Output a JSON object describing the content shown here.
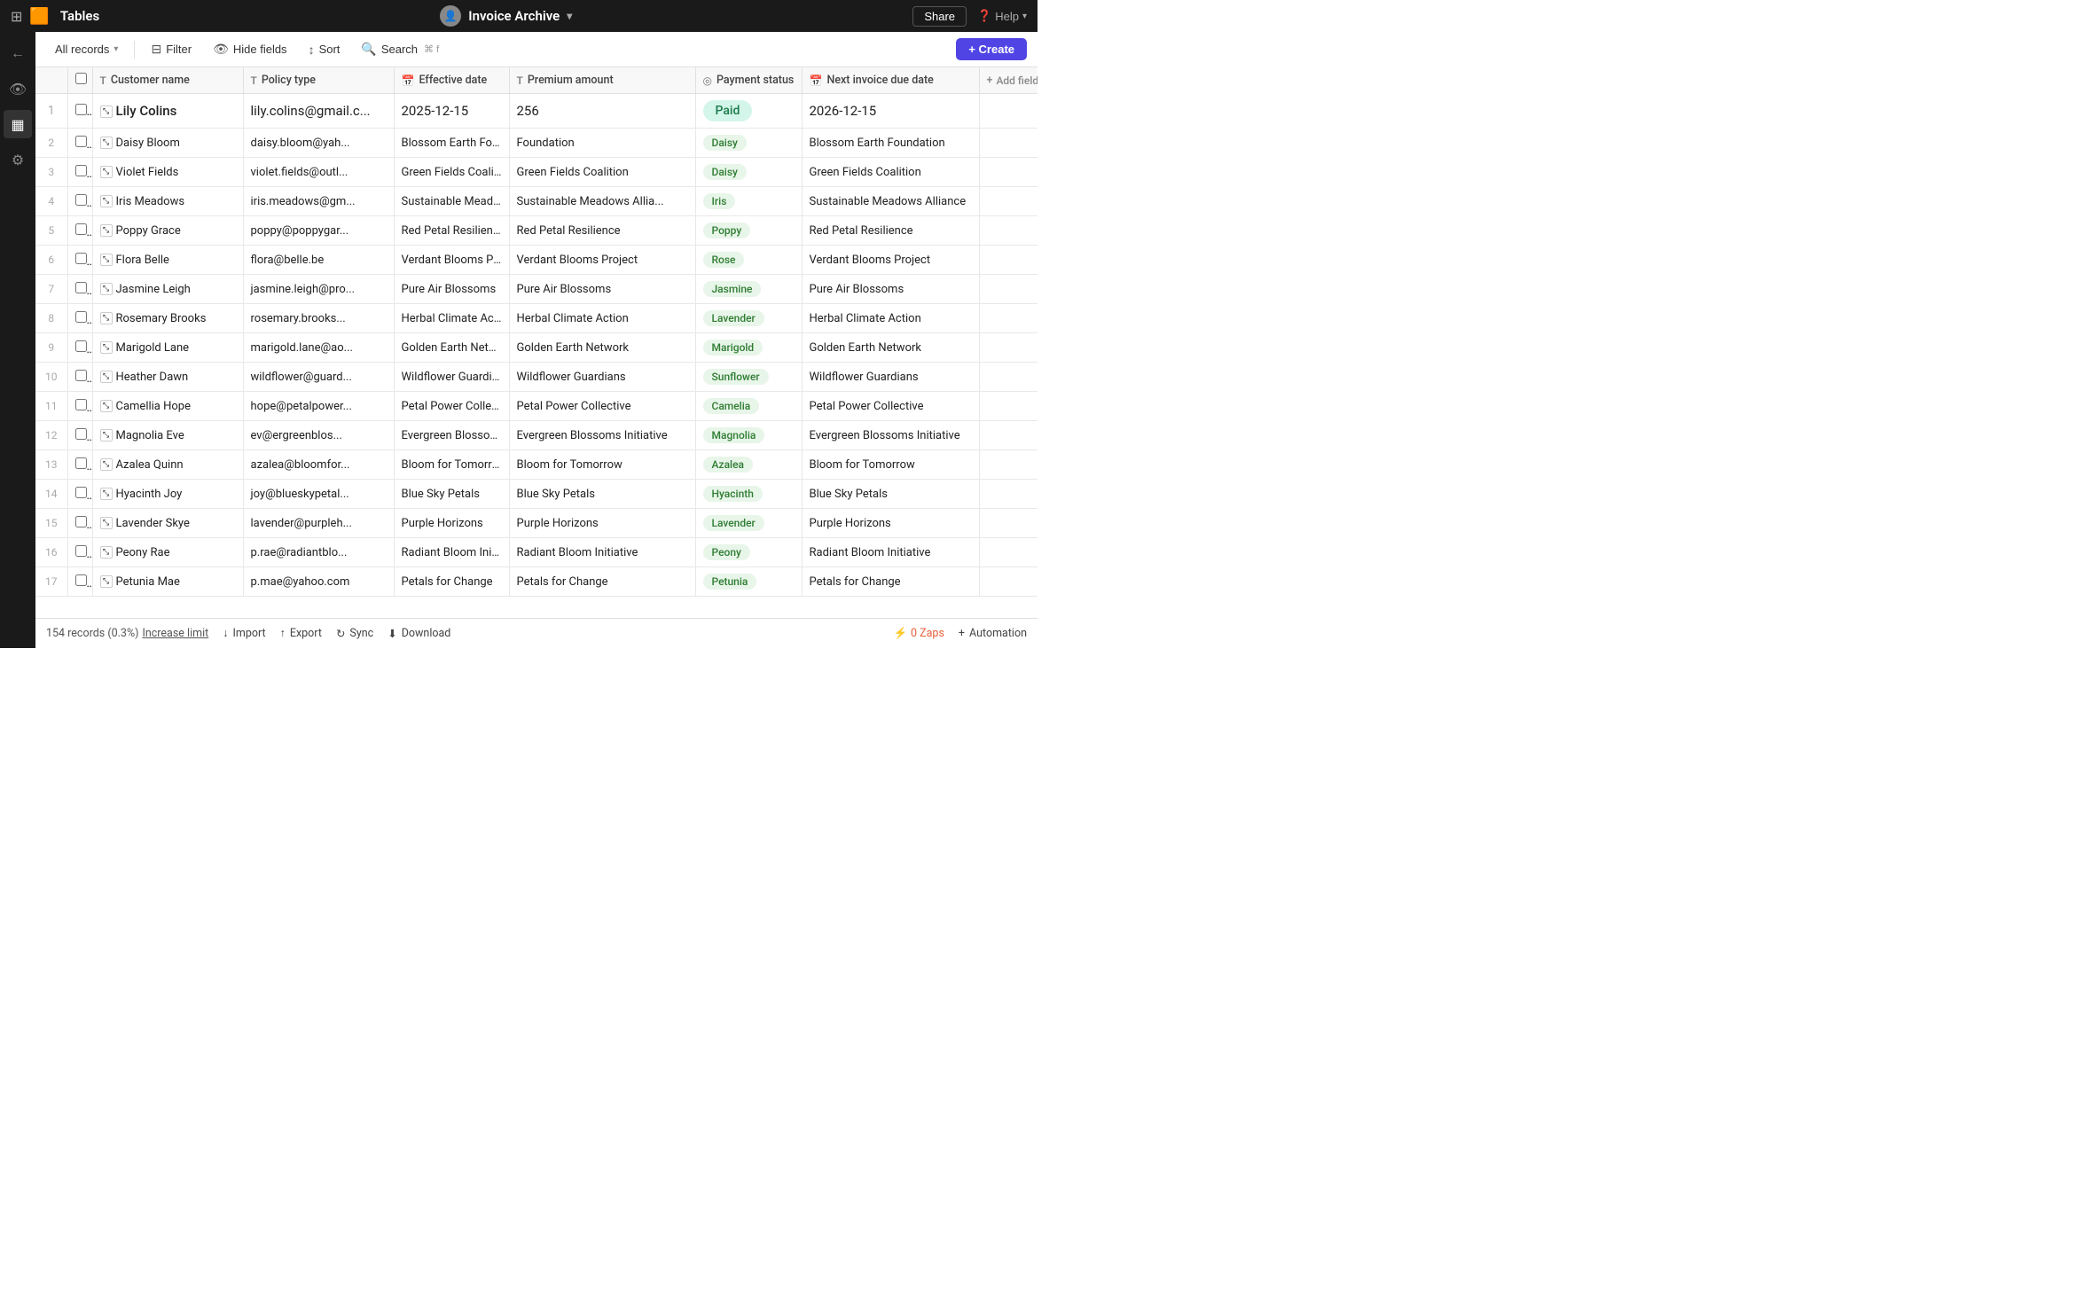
{
  "app": {
    "title": "Invoice Archive",
    "logoText": "Tables",
    "shareLabel": "Share",
    "helpLabel": "Help"
  },
  "toolbar": {
    "allRecordsLabel": "All records",
    "filterLabel": "Filter",
    "hideFieldsLabel": "Hide fields",
    "sortLabel": "Sort",
    "searchLabel": "Search",
    "searchShortcut": "⌘ f",
    "createLabel": "+ Create"
  },
  "columns": [
    {
      "id": "customer-name",
      "label": "Customer name",
      "icon": "T"
    },
    {
      "id": "policy-type",
      "label": "Policy type",
      "icon": "T"
    },
    {
      "id": "effective-date",
      "label": "Effective date",
      "icon": "📅"
    },
    {
      "id": "premium-amount",
      "label": "Premium amount",
      "icon": "T"
    },
    {
      "id": "payment-status",
      "label": "Payment status",
      "icon": "◎"
    },
    {
      "id": "next-invoice",
      "label": "Next invoice due date",
      "icon": "📅"
    }
  ],
  "rows": [
    {
      "num": 1,
      "name": "Lily Colins",
      "email": "lily.colins@gmail.c...",
      "policy": "2025-12-15",
      "effective": "",
      "premium": "256",
      "paymentStatus": "Paid",
      "paymentBadge": "paid",
      "nextInvoice": "2026-12-15",
      "isFirst": true
    },
    {
      "num": 2,
      "name": "Daisy Bloom",
      "email": "daisy.bloom@yah...",
      "policy": "Blossom Earth Foundation",
      "effective": "Foundation",
      "premium": "Daisy",
      "paymentStatus": "Daisy",
      "paymentBadge": "daisy",
      "nextInvoice": "Blossom Earth Foundation",
      "isFirst": false
    },
    {
      "num": 3,
      "name": "Violet Fields",
      "email": "violet.fields@outl...",
      "policy": "Green Fields Coalition",
      "effective": "Green Fields Coalition",
      "premium": "Green Fields Coalition",
      "paymentStatus": "Daisy",
      "paymentBadge": "daisy",
      "nextInvoice": "Green Fields Coalition",
      "isFirst": false
    },
    {
      "num": 4,
      "name": "Iris Meadows",
      "email": "iris.meadows@gm...",
      "policy": "Sustainable Meadows Alliance",
      "effective": "Sustainable Meadows Allia...",
      "premium": "Sustainable Meadows Allia",
      "paymentStatus": "Iris",
      "paymentBadge": "iris",
      "nextInvoice": "Sustainable Meadows Alliance",
      "isFirst": false
    },
    {
      "num": 5,
      "name": "Poppy Grace",
      "email": "poppy@poppygar...",
      "policy": "Red Petal Resilience",
      "effective": "Red Petal Resilience",
      "premium": "Red Petal Resilience",
      "paymentStatus": "Poppy",
      "paymentBadge": "poppy",
      "nextInvoice": "Red Petal Resilience",
      "isFirst": false
    },
    {
      "num": 6,
      "name": "Flora Belle",
      "email": "flora@belle.be",
      "policy": "Verdant Blooms Project",
      "effective": "Verdant Blooms Project",
      "premium": "Verdant Blooms Project",
      "paymentStatus": "Rose",
      "paymentBadge": "rose",
      "nextInvoice": "Verdant Blooms Project",
      "isFirst": false
    },
    {
      "num": 7,
      "name": "Jasmine Leigh",
      "email": "jasmine.leigh@pro...",
      "policy": "Pure Air Blossoms",
      "effective": "Pure Air Blossoms",
      "premium": "Pure Air Blossoms",
      "paymentStatus": "Jasmine",
      "paymentBadge": "jasmine",
      "nextInvoice": "Pure Air Blossoms",
      "isFirst": false
    },
    {
      "num": 8,
      "name": "Rosemary Brooks",
      "email": "rosemary.brooks...",
      "policy": "Herbal Climate Action",
      "effective": "Herbal Climate Action",
      "premium": "Herbal Climate Action",
      "paymentStatus": "Lavender",
      "paymentBadge": "lavender",
      "nextInvoice": "Herbal Climate Action",
      "isFirst": false
    },
    {
      "num": 9,
      "name": "Marigold Lane",
      "email": "marigold.lane@ao...",
      "policy": "Golden Earth Network",
      "effective": "Golden Earth Network",
      "premium": "Golden Earth Network",
      "paymentStatus": "Marigold",
      "paymentBadge": "marigold",
      "nextInvoice": "Golden Earth Network",
      "isFirst": false
    },
    {
      "num": 10,
      "name": "Heather Dawn",
      "email": "wildflower@guard...",
      "policy": "Wildflower Guardians",
      "effective": "Wildflower Guardians",
      "premium": "Wildflower Guardians",
      "paymentStatus": "Sunflower",
      "paymentBadge": "sunflower",
      "nextInvoice": "Wildflower Guardians",
      "isFirst": false
    },
    {
      "num": 11,
      "name": "Camellia Hope",
      "email": "hope@petalpower...",
      "policy": "Petal Power Collective",
      "effective": "Petal Power Collective",
      "premium": "Petal Power Collective",
      "paymentStatus": "Camelia",
      "paymentBadge": "camelia",
      "nextInvoice": "Petal Power Collective",
      "isFirst": false
    },
    {
      "num": 12,
      "name": "Magnolia Eve",
      "email": "ev@ergreenblos...",
      "policy": "Evergreen Blossoms Initiative",
      "effective": "Evergreen Blossoms Initiative",
      "premium": "Evergreen Blossoms Initiative",
      "paymentStatus": "Magnolia",
      "paymentBadge": "magnolia",
      "nextInvoice": "Evergreen Blossoms Initiative",
      "isFirst": false
    },
    {
      "num": 13,
      "name": "Azalea Quinn",
      "email": "azalea@bloomfor...",
      "policy": "Bloom for Tomorrow",
      "effective": "Bloom for Tomorrow",
      "premium": "Bloom for Tomorrow",
      "paymentStatus": "Azalea",
      "paymentBadge": "azalea",
      "nextInvoice": "Bloom for Tomorrow",
      "isFirst": false
    },
    {
      "num": 14,
      "name": "Hyacinth Joy",
      "email": "joy@blueskypetal...",
      "policy": "Blue Sky Petals",
      "effective": "Blue Sky Petals",
      "premium": "Blue Sky Petals",
      "paymentStatus": "Hyacinth",
      "paymentBadge": "hyacinth",
      "nextInvoice": "Blue Sky Petals",
      "isFirst": false
    },
    {
      "num": 15,
      "name": "Lavender Skye",
      "email": "lavender@purpleh...",
      "policy": "Purple Horizons",
      "effective": "Purple Horizons",
      "premium": "Purple Horizons",
      "paymentStatus": "Lavender",
      "paymentBadge": "lavender",
      "nextInvoice": "Purple Horizons",
      "isFirst": false
    },
    {
      "num": 16,
      "name": "Peony Rae",
      "email": "p.rae@radiantblo...",
      "policy": "Radiant Bloom Initiative",
      "effective": "Radiant Bloom Initiative",
      "premium": "Radiant Bloom Initiative",
      "paymentStatus": "Peony",
      "paymentBadge": "peony",
      "nextInvoice": "Radiant Bloom Initiative",
      "isFirst": false
    },
    {
      "num": 17,
      "name": "Petunia Mae",
      "email": "p.mae@yahoo.com",
      "policy": "Petals for Change",
      "effective": "Petals for Change",
      "premium": "Petals for Change",
      "paymentStatus": "Petunia",
      "paymentBadge": "petunia",
      "nextInvoice": "Petals for Change",
      "isFirst": false
    }
  ],
  "statusbar": {
    "records": "154 records (0.3%)",
    "increaseLimitLabel": "Increase limit",
    "importLabel": "Import",
    "exportLabel": "Export",
    "syncLabel": "Sync",
    "downloadLabel": "Download",
    "zapsLabel": "0 Zaps",
    "automationLabel": "Automation"
  }
}
